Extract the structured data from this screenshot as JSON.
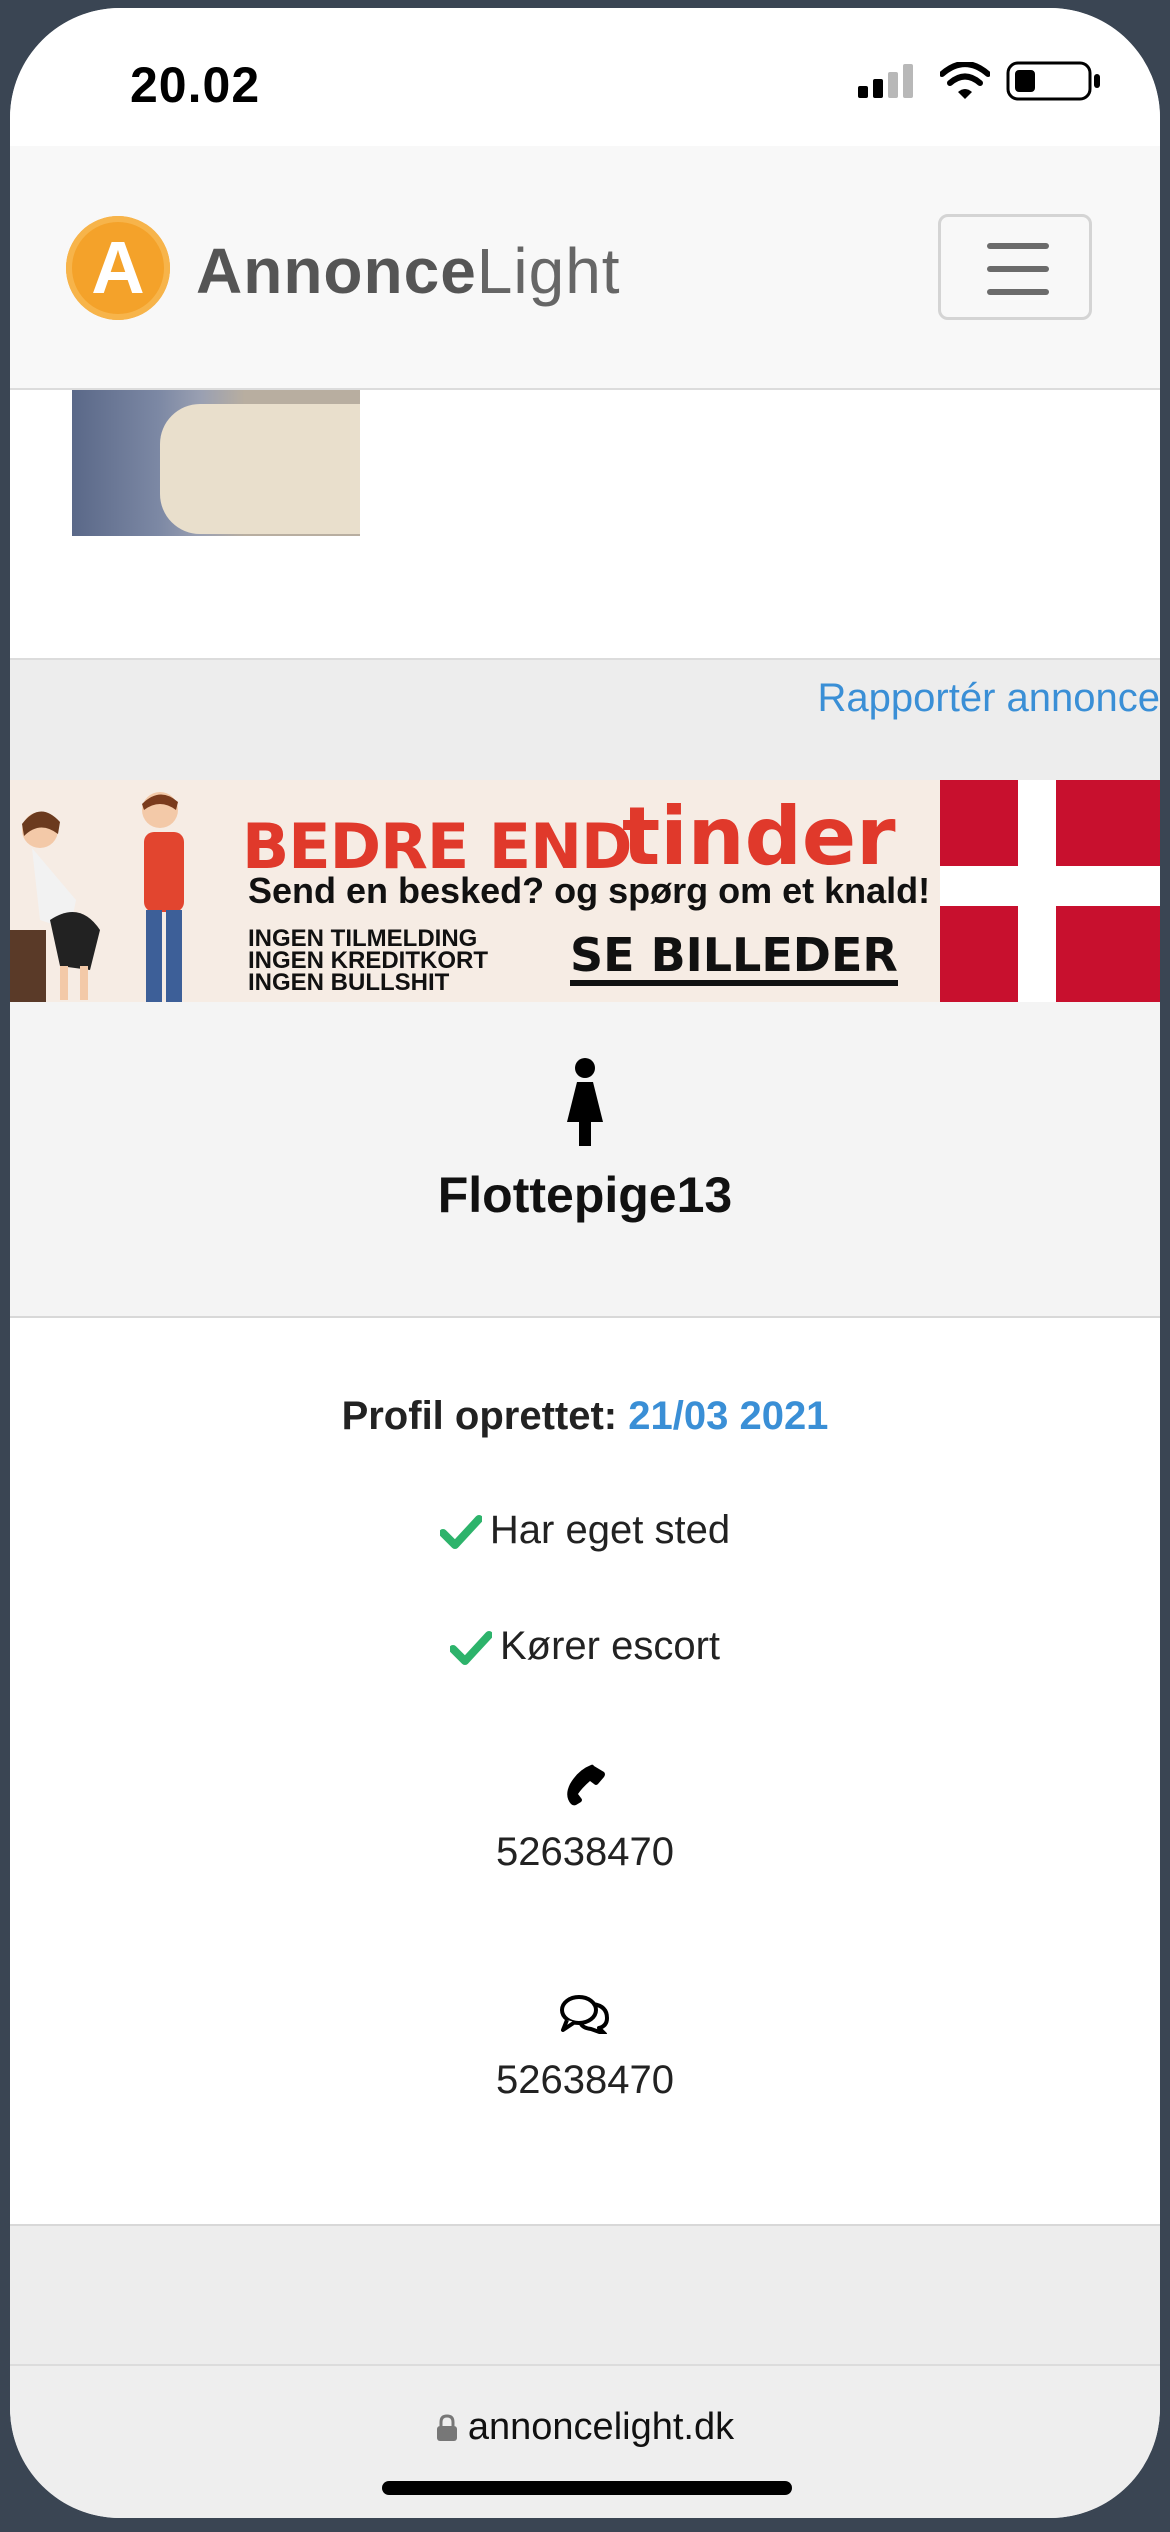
{
  "status_bar": {
    "time": "20.02"
  },
  "nav": {
    "logo_letter": "A",
    "brand_bold": "Annonce",
    "brand_light": "Light"
  },
  "report_link": "Rapportér annonce",
  "banner": {
    "headline": "BEDRE END",
    "brand": "tinder",
    "subline": "Send en besked? og spørg om et knald!",
    "bullets": [
      "INGEN TILMELDING",
      "INGEN KREDITKORT",
      "INGEN BULLSHIT"
    ],
    "cta": "SE BILLEDER"
  },
  "profile": {
    "username": "Flottepige13",
    "created_label": "Profil oprettet:",
    "created_date": "21/03 2021",
    "features": [
      "Har eget sted",
      "Kører escort"
    ],
    "phone": "52638470",
    "sms": "52638470"
  },
  "browser": {
    "url": "annoncelight.dk"
  },
  "colors": {
    "accent_blue": "#3a8fd6",
    "check_green": "#2db36b",
    "logo_orange": "#f4a22a",
    "flag_red": "#c8102e"
  }
}
